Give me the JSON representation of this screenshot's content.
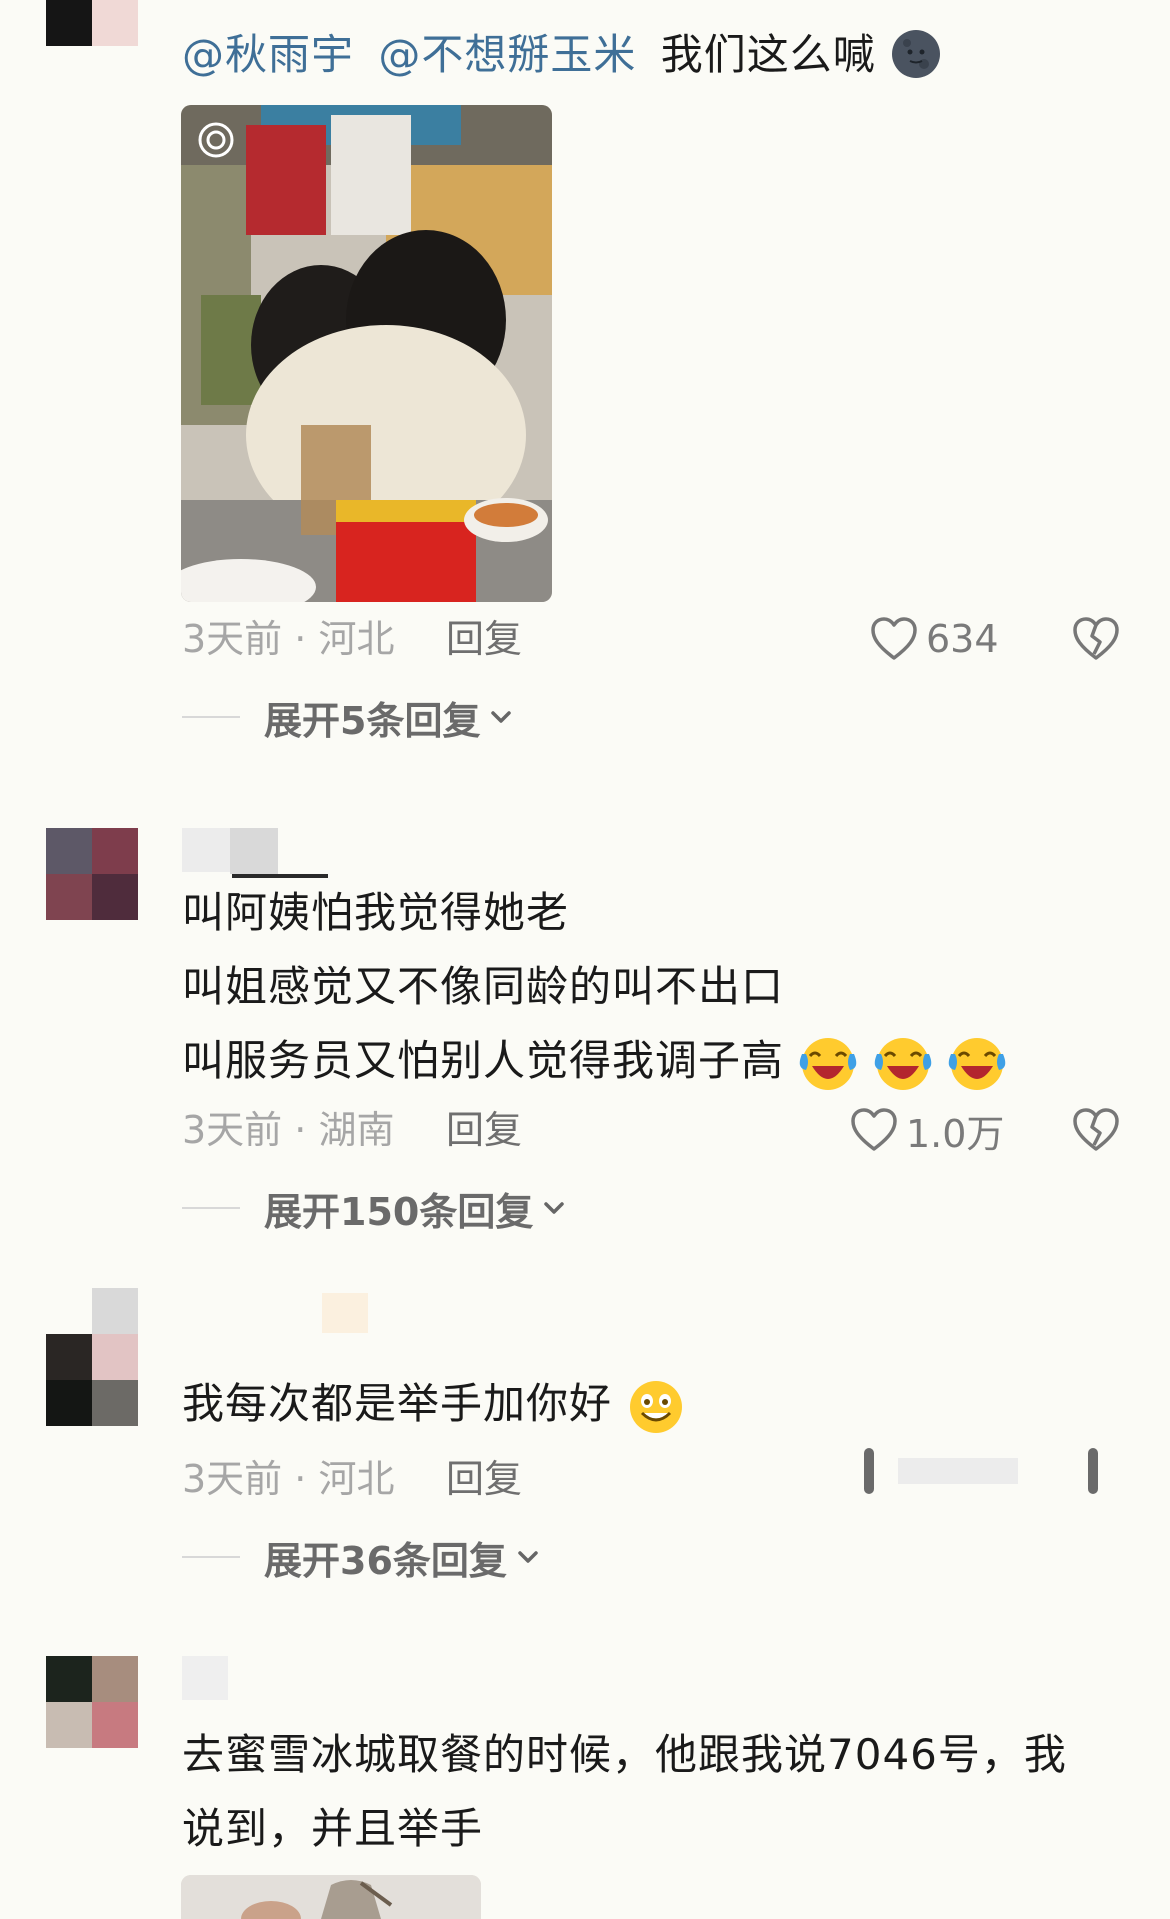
{
  "comments": [
    {
      "mentions": [
        "@秋雨宇",
        "@不想掰玉米"
      ],
      "text": "我们这么喊",
      "time": "3天前",
      "location": "河北",
      "reply_label": "回复",
      "likes": "634",
      "expand_label": "展开5条回复"
    },
    {
      "lines": [
        "叫阿姨怕我觉得她老",
        "叫姐感觉又不像同龄的叫不出口",
        "叫服务员又怕别人觉得我调子高"
      ],
      "time": "3天前",
      "location": "湖南",
      "reply_label": "回复",
      "likes": "1.0万",
      "expand_label": "展开150条回复"
    },
    {
      "text": "我每次都是举手加你好",
      "time": "3天前",
      "location": "河北",
      "reply_label": "回复",
      "expand_label": "展开36条回复"
    },
    {
      "lines": [
        "去蜜雪冰城取餐的时候，他跟我说7046号，我",
        "说到，并且举手"
      ]
    }
  ],
  "colors": {
    "mention": "#3f6f97",
    "meta": "#a6a6a6",
    "reply": "#6f6f6f",
    "background": "#fbfbf6"
  },
  "icons": [
    "heart-outline-icon",
    "broken-heart-icon",
    "chevron-down-icon",
    "moon-face-emoji",
    "laughing-crying-emoji",
    "smiling-emoji"
  ]
}
